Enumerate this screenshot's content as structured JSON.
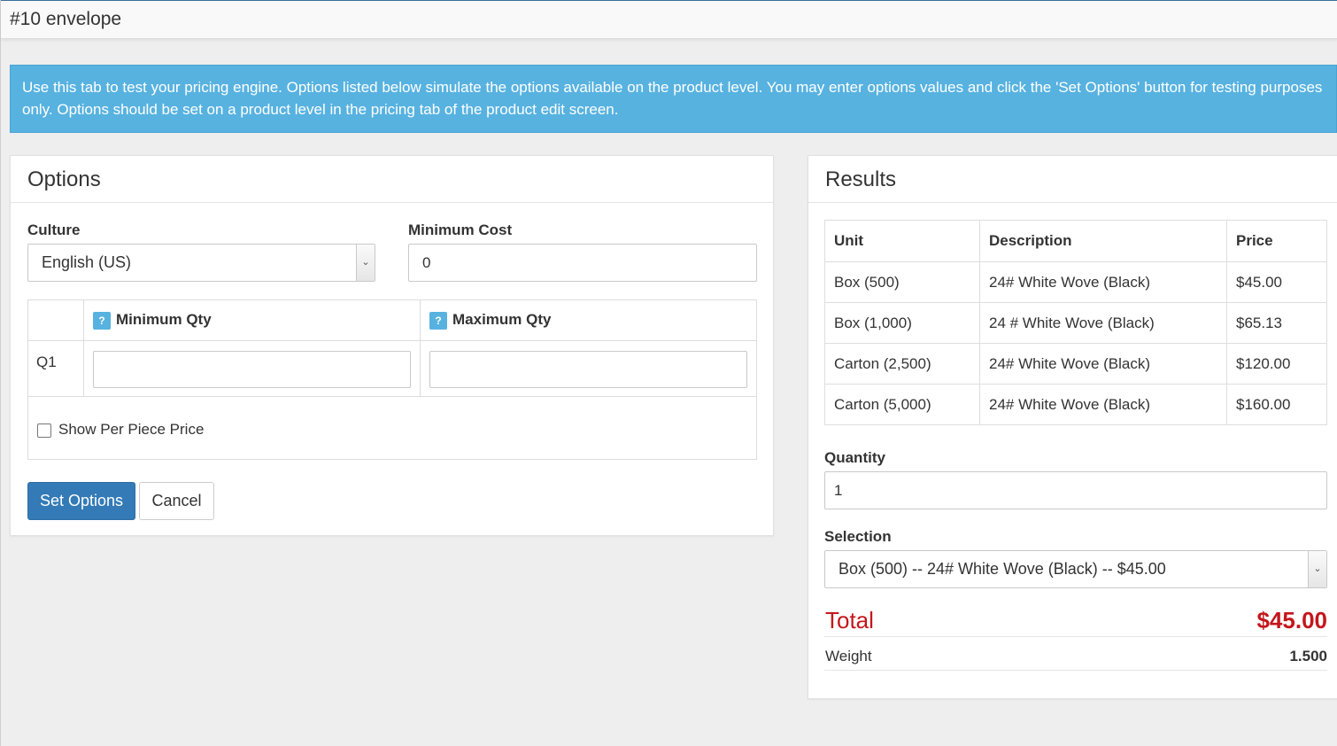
{
  "page": {
    "title": "#10 envelope"
  },
  "alert": {
    "text": "Use this tab to test your pricing engine. Options listed below simulate the options available on the product level. You may enter options values and click the 'Set Options' button for testing purposes only. Options should be set on a product level in the pricing tab of the product edit screen."
  },
  "options": {
    "heading": "Options",
    "culture_label": "Culture",
    "culture_value": "English (US)",
    "min_cost_label": "Minimum Cost",
    "min_cost_value": "0",
    "qty_table": {
      "help_glyph": "?",
      "min_qty_header": "Minimum Qty",
      "max_qty_header": "Maximum Qty",
      "row_label": "Q1",
      "min_value": "",
      "max_value": ""
    },
    "show_per_piece_label": "Show Per Piece Price",
    "show_per_piece_checked": false,
    "set_options_label": "Set Options",
    "cancel_label": "Cancel"
  },
  "results": {
    "heading": "Results",
    "columns": [
      "Unit",
      "Description",
      "Price"
    ],
    "rows": [
      {
        "unit": "Box (500)",
        "description": "24# White Wove (Black)",
        "price": "$45.00"
      },
      {
        "unit": "Box (1,000)",
        "description": "24 # White Wove (Black)",
        "price": "$65.13"
      },
      {
        "unit": "Carton (2,500)",
        "description": "24# White Wove (Black)",
        "price": "$120.00"
      },
      {
        "unit": "Carton (5,000)",
        "description": "24# White Wove (Black)",
        "price": "$160.00"
      }
    ],
    "quantity_label": "Quantity",
    "quantity_value": "1",
    "selection_label": "Selection",
    "selection_value": "Box (500) -- 24# White Wove (Black) -- $45.00",
    "total_label": "Total",
    "total_value": "$45.00",
    "weight_label": "Weight",
    "weight_value": "1.500"
  },
  "colors": {
    "alert_bg": "#57b2e0",
    "primary_button": "#337ab7",
    "total_text": "#c4161c"
  },
  "icons": {
    "select_arrow": "chevron-down-icon",
    "help": "help-icon"
  }
}
